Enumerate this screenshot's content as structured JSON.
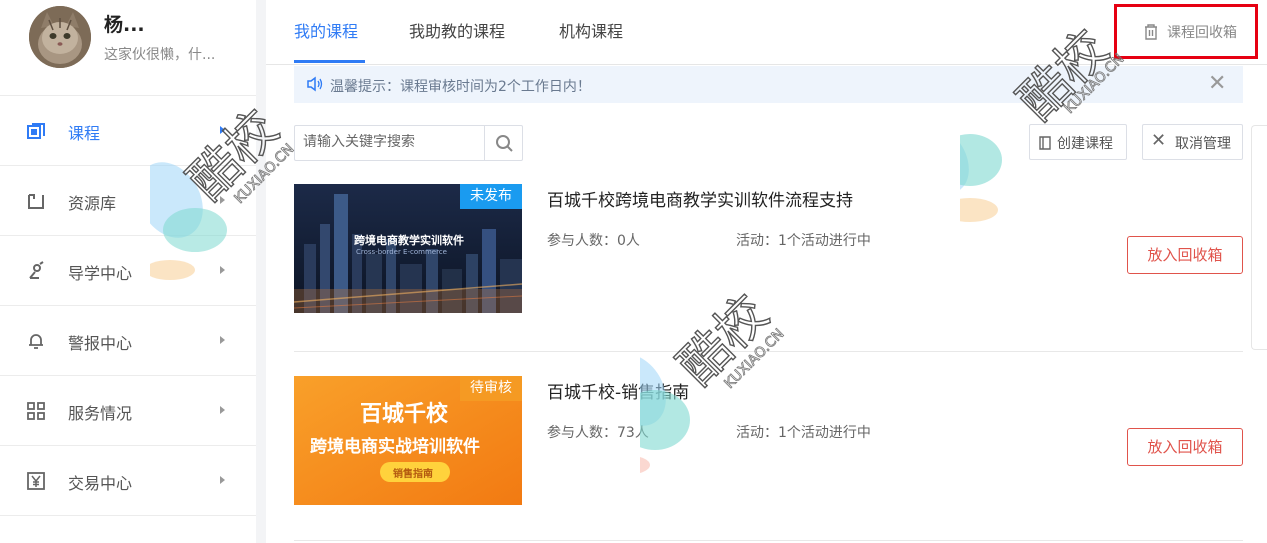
{
  "user": {
    "name": "杨...",
    "signature": "这家伙很懒，什..."
  },
  "sidebar": {
    "items": [
      {
        "label": "课程",
        "icon": "course-icon",
        "active": true
      },
      {
        "label": "资源库",
        "icon": "folder-icon"
      },
      {
        "label": "导学中心",
        "icon": "guide-icon"
      },
      {
        "label": "警报中心",
        "icon": "bell-icon"
      },
      {
        "label": "服务情况",
        "icon": "grid-icon"
      },
      {
        "label": "交易中心",
        "icon": "yen-icon"
      }
    ]
  },
  "tabs": [
    "我的课程",
    "我助教的课程",
    "机构课程"
  ],
  "recycle_bin": {
    "label": "课程回收箱",
    "icon": "trash-icon"
  },
  "notice": {
    "text": "温馨提示：课程审核时间为2个工作日内！"
  },
  "search": {
    "placeholder": "请输入关键字搜索"
  },
  "toolbar": {
    "create_label": "创建课程",
    "cancel_manage_label": "取消管理"
  },
  "courses": [
    {
      "status": "未发布",
      "title": "百城千校跨境电商教学实训软件流程支持",
      "participants": "参与人数：0人",
      "activity": "活动：1个活动进行中",
      "recycle_label": "放入回收箱",
      "thumb_text": "跨境电商教学实训软件",
      "thumb_subtext": "Cross-border E-commerce"
    },
    {
      "status": "待审核",
      "title": "百城千校-销售指南",
      "participants": "参与人数：73人",
      "activity": "活动：1个活动进行中",
      "recycle_label": "放入回收箱",
      "thumb_text": "百城千校",
      "thumb_line2": "跨境电商实战培训软件",
      "thumb_pill": "销售指南"
    }
  ],
  "watermark": {
    "text": "酷校",
    "domain": "KUXIAO.CN"
  },
  "colors": {
    "accent": "#2f7bf5",
    "danger": "#e0534b",
    "highlight": "#e60012",
    "badge_unpublished": "#1a9bf0",
    "badge_pending": "#f59a23"
  }
}
